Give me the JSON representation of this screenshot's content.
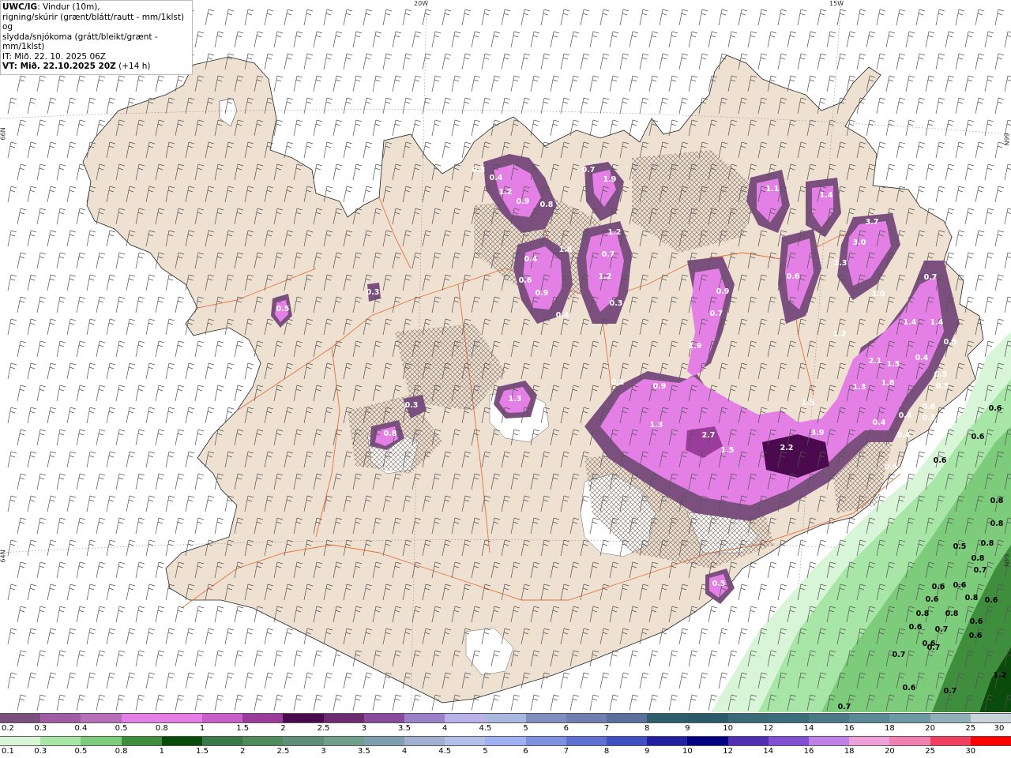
{
  "header": {
    "line1_model": "UWC/IG",
    "line1_rest": ": Vindur (10m),",
    "line2": "rigning/skúrir (grænt/blátt/rautt - mm/1klst) og",
    "line3": "slydda/snjókoma (grátt/bleikt/grænt - mm/1klst)",
    "line4": "IT: Mið. 22. 10. 2025 06Z",
    "line5_bold": "VT: Mið. 22.10.2025 20Z",
    "line5_rest": " (+14 h)"
  },
  "grid_labels": {
    "lon_20w": "20W",
    "lon_15w": "15W",
    "lat_66n_left": "66N",
    "lat_66n_right": "66N",
    "lat_64n_left": "64N",
    "lat_64n_right": "64N"
  },
  "colorbar_top": {
    "labels": [
      "0.2",
      "0.3",
      "0.4",
      "0.5",
      "0.8",
      "1",
      "1.5",
      "2",
      "2.5",
      "3",
      "3.5",
      "4",
      "4.5",
      "5",
      "6",
      "7",
      "8",
      "9",
      "10",
      "12",
      "14",
      "16",
      "18",
      "20",
      "25",
      "30"
    ],
    "colors": [
      "#7b4f7e",
      "#a05ca3",
      "#b66fb8",
      "#e47fe6",
      "#e67ce6",
      "#c85ec9",
      "#9b3c9d",
      "#4a0a4d",
      "#6e2a70",
      "#8a4a9b",
      "#9a80c8",
      "#b9b2e8",
      "#aab8e0",
      "#7f8fc0",
      "#6e7fb0",
      "#5a6f9c",
      "#2e5e6e",
      "#2b5a6a",
      "#3a6a78",
      "#3c6d7a",
      "#4b7a86",
      "#5a8a96",
      "#6b9aa4",
      "#8fb0b8",
      "#c8d4d8"
    ]
  },
  "colorbar_bottom": {
    "labels": [
      "0.1",
      "0.3",
      "0.5",
      "0.8",
      "1",
      "1.5",
      "2",
      "2.5",
      "3",
      "3.5",
      "4",
      "4.5",
      "5",
      "6",
      "7",
      "8",
      "9",
      "10",
      "12",
      "14",
      "16",
      "18",
      "20",
      "25",
      "30"
    ],
    "colors": [
      "#d8f5d8",
      "#a8e6a8",
      "#7ccc7c",
      "#3e8e3e",
      "#0a4a0a",
      "#3a7a4a",
      "#4f8a5a",
      "#5f8f7a",
      "#6f9f8a",
      "#7f9fb0",
      "#9fb0d0",
      "#b0c0e8",
      "#a0b0f0",
      "#8090e0",
      "#6070d0",
      "#4050c0",
      "#2020a0",
      "#000080",
      "#5030b0",
      "#8050d0",
      "#c080e8",
      "#f0a0d8",
      "#f080b0",
      "#f04060",
      "#ff0000"
    ]
  },
  "snow_values": [
    {
      "v": "0.3"
    },
    {
      "v": "0.4"
    },
    {
      "v": "1.2"
    },
    {
      "v": "0.9"
    },
    {
      "v": "0.8"
    },
    {
      "v": "0.7"
    },
    {
      "v": "1.9"
    },
    {
      "v": "1.1"
    },
    {
      "v": "1.4"
    },
    {
      "v": "3.7"
    },
    {
      "v": "3.0"
    },
    {
      "v": "2.3"
    },
    {
      "v": "1.8"
    },
    {
      "v": "0.4"
    },
    {
      "v": "1.2"
    },
    {
      "v": "0.6"
    },
    {
      "v": "0.9"
    },
    {
      "v": "0.7"
    },
    {
      "v": "1.2"
    },
    {
      "v": "0.3"
    },
    {
      "v": "0.4"
    },
    {
      "v": "0.5"
    },
    {
      "v": "0.9"
    },
    {
      "v": "0.7"
    },
    {
      "v": "0.6"
    },
    {
      "v": "1.0"
    },
    {
      "v": "1.2"
    },
    {
      "v": "1.9"
    },
    {
      "v": "0.2"
    },
    {
      "v": "0.9"
    },
    {
      "v": "2.1"
    },
    {
      "v": "1.5"
    },
    {
      "v": "1.8"
    },
    {
      "v": "1.3"
    },
    {
      "v": "1.5"
    },
    {
      "v": "1.4"
    },
    {
      "v": "0.7"
    },
    {
      "v": "1.4"
    },
    {
      "v": "0.8"
    },
    {
      "v": "0.4"
    },
    {
      "v": "0.5"
    },
    {
      "v": "0.5"
    },
    {
      "v": "0.6"
    },
    {
      "v": "0.4"
    },
    {
      "v": "1.3"
    },
    {
      "v": "2.7"
    },
    {
      "v": "1.5"
    },
    {
      "v": "2.2"
    },
    {
      "v": "3.9"
    },
    {
      "v": "0.4"
    },
    {
      "v": "0.5"
    },
    {
      "v": "0.3"
    },
    {
      "v": "0.8"
    },
    {
      "v": "0.3"
    },
    {
      "v": "1.3"
    },
    {
      "v": "0.4"
    },
    {
      "v": "0.5"
    },
    {
      "v": "0.5"
    }
  ],
  "rain_values": [
    {
      "v": "0.6"
    },
    {
      "v": "0.6"
    },
    {
      "v": "0.6"
    },
    {
      "v": "0.8"
    },
    {
      "v": "0.8"
    },
    {
      "v": "0.5"
    },
    {
      "v": "0.8"
    },
    {
      "v": "0.8"
    },
    {
      "v": "0.7"
    },
    {
      "v": "0.6"
    },
    {
      "v": "0.6"
    },
    {
      "v": "0.8"
    },
    {
      "v": "0.6"
    },
    {
      "v": "0.6"
    },
    {
      "v": "0.8"
    },
    {
      "v": "0.8"
    },
    {
      "v": "0.6"
    },
    {
      "v": "0.6"
    },
    {
      "v": "0.7"
    },
    {
      "v": "0.6"
    },
    {
      "v": "0.6"
    },
    {
      "v": "0.7"
    },
    {
      "v": "0.7"
    },
    {
      "v": "1.2"
    },
    {
      "v": "0.6"
    },
    {
      "v": "0.7"
    },
    {
      "v": "0.7"
    }
  ],
  "colors": {
    "land": "#efe1d2",
    "roads": "#e8703a",
    "sea": "#ffffff",
    "barb": "#555555"
  }
}
